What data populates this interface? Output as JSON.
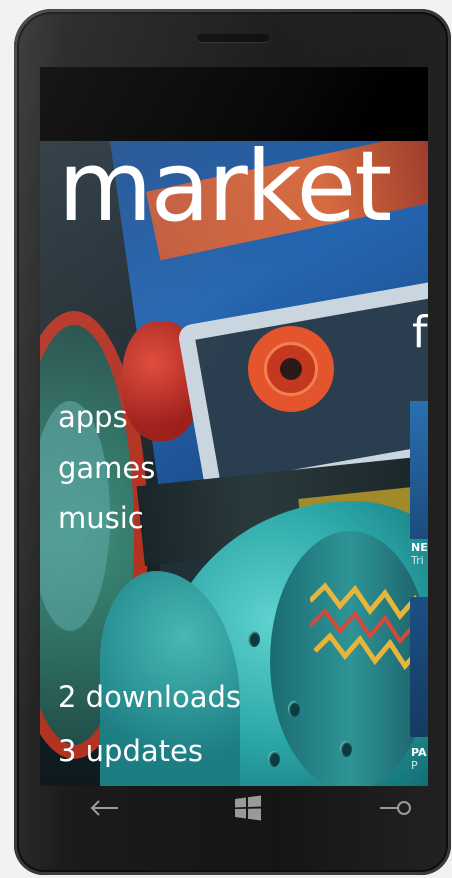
{
  "hub": {
    "title": "market",
    "panorama_peek": "f"
  },
  "menu": {
    "items": [
      "apps",
      "games",
      "music"
    ]
  },
  "status_links": {
    "downloads": "2 downloads",
    "updates": "3 updates"
  },
  "featured": [
    {
      "name": "NE",
      "sub": "Tri"
    },
    {
      "name": "PA",
      "sub": "P"
    }
  ],
  "hardware_buttons": {
    "back": "back-arrow-icon",
    "start": "windows-logo-icon",
    "search": "search-icon"
  },
  "colors": {
    "text": "#ffffff",
    "phone_body": "#1b1b1b",
    "page_background": "#f1f2f3"
  }
}
